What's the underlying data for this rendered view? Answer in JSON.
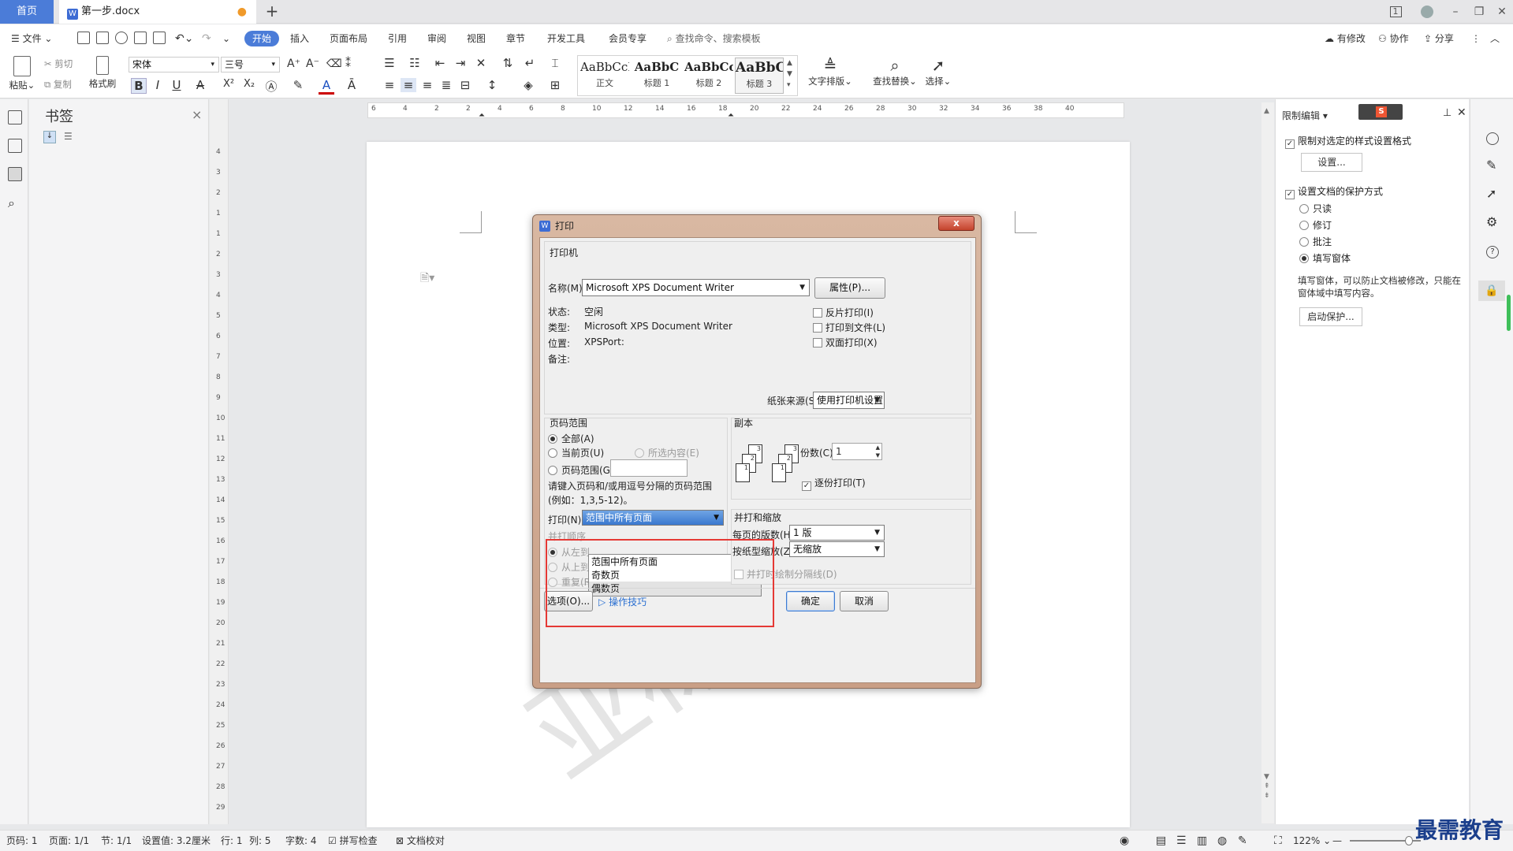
{
  "titlebar": {
    "home_tab": "首页",
    "doc_tab": "第一步.docx",
    "doc_tab_icon": "W",
    "new_tab": "+",
    "dirty_mark": "●",
    "page_badge": "1"
  },
  "menu": {
    "file": "文件",
    "items": [
      "开始",
      "插入",
      "页面布局",
      "引用",
      "审阅",
      "视图",
      "章节",
      "开发工具",
      "会员专享"
    ],
    "search_placeholder": "查找命令、搜索模板",
    "right": [
      "有修改",
      "协作",
      "分享"
    ]
  },
  "ribbon": {
    "paste": "粘贴",
    "cut": "剪切",
    "copy": "复制",
    "format_painter": "格式刷",
    "font_name": "宋体",
    "font_size": "三号",
    "styles": [
      {
        "preview": "AaBbCcI",
        "name": "正文"
      },
      {
        "preview": "AaBbC",
        "name": "标题 1"
      },
      {
        "preview": "AaBbCc",
        "name": "标题 2"
      },
      {
        "preview": "AaBbC",
        "name": "标题 3"
      }
    ],
    "text_layout": "文字排版",
    "find_replace": "查找替换",
    "select": "选择",
    "fmt": {
      "bold": "B",
      "italic": "I",
      "underline": "U",
      "strike": "A",
      "sup": "X²",
      "sub": "X₂",
      "fontcolor": "A"
    }
  },
  "bookmark_panel": {
    "title": "书签",
    "close": "×"
  },
  "hruler_labels": [
    "6",
    "4",
    "2",
    "2",
    "4",
    "6",
    "8",
    "10",
    "12",
    "14",
    "16",
    "18",
    "20",
    "22",
    "24",
    "26",
    "28",
    "30",
    "32",
    "34",
    "36",
    "38",
    "40"
  ],
  "vruler_labels": [
    "4",
    "3",
    "2",
    "1",
    "1",
    "2",
    "3",
    "4",
    "5",
    "6",
    "7",
    "8",
    "9",
    "10",
    "11",
    "12",
    "13",
    "14",
    "15",
    "16",
    "17",
    "18",
    "19",
    "20",
    "21",
    "22",
    "23",
    "24",
    "25",
    "26",
    "27",
    "28",
    "29"
  ],
  "right_panel": {
    "title": "限制编辑",
    "opt1": "限制对选定的样式设置格式",
    "settings_btn": "设置...",
    "opt2": "设置文档的保护方式",
    "modes": [
      "只读",
      "修订",
      "批注",
      "填写窗体"
    ],
    "selected_mode": "填写窗体",
    "hint": "填写窗体，可以防止文档被修改，只能在窗体域中填写内容。",
    "start_btn": "启动保护..."
  },
  "dialog": {
    "title": "打印",
    "close": "x",
    "printer_group": "打印机",
    "name_label": "名称(M):",
    "printer_name": "Microsoft XPS Document Writer",
    "props_btn": "属性(P)...",
    "status_label": "状态:",
    "status_value": "空闲",
    "type_label": "类型:",
    "type_value": "Microsoft XPS Document Writer",
    "location_label": "位置:",
    "location_value": "XPSPort:",
    "comment_label": "备注:",
    "reverse": "反片打印(I)",
    "to_file": "打印到文件(L)",
    "duplex": "双面打印(X)",
    "paper_source_label": "纸张来源(S):",
    "paper_source": "使用打印机设置",
    "range_group": "页码范围",
    "range_all": "全部(A)",
    "range_current": "当前页(U)",
    "range_selection": "所选内容(E)",
    "range_pages": "页码范围(G):",
    "range_hint": "请键入页码和/或用逗号分隔的页码范围(例如：1,3,5-12)。",
    "print_label": "打印(N):",
    "print_value": "范围中所有页面",
    "dropdown_options": [
      "范围中所有页面",
      "奇数页",
      "偶数页"
    ],
    "collate_order": "并打顺序",
    "left_to_right": "从左到",
    "top_to_bottom": "从上到下(B)",
    "repeat": "重复(R)",
    "copies_group": "副本",
    "copies_label": "份数(C):",
    "copies_value": "1",
    "collate": "逐份打印(T)",
    "scale_group": "并打和缩放",
    "pages_per_sheet_label": "每页的版数(H):",
    "pages_per_sheet": "1 版",
    "scale_label": "按纸型缩放(Z):",
    "scale_value": "无缩放",
    "draw_lines": "并打时绘制分隔线(D)",
    "options_btn": "选项(O)...",
    "tips": "操作技巧",
    "ok": "确定",
    "cancel": "取消"
  },
  "statusbar": {
    "page_no": "页码: 1",
    "pages": "页面: 1/1",
    "section": "节: 1/1",
    "setting": "设置值: 3.2厘米",
    "row": "行: 1",
    "col": "列: 5",
    "words": "字数: 4",
    "spell": "拼写检查",
    "proof": "文档校对",
    "zoom": "122%"
  },
  "watermark_logo": "最需教育",
  "doc_watermark": "亚棕少"
}
